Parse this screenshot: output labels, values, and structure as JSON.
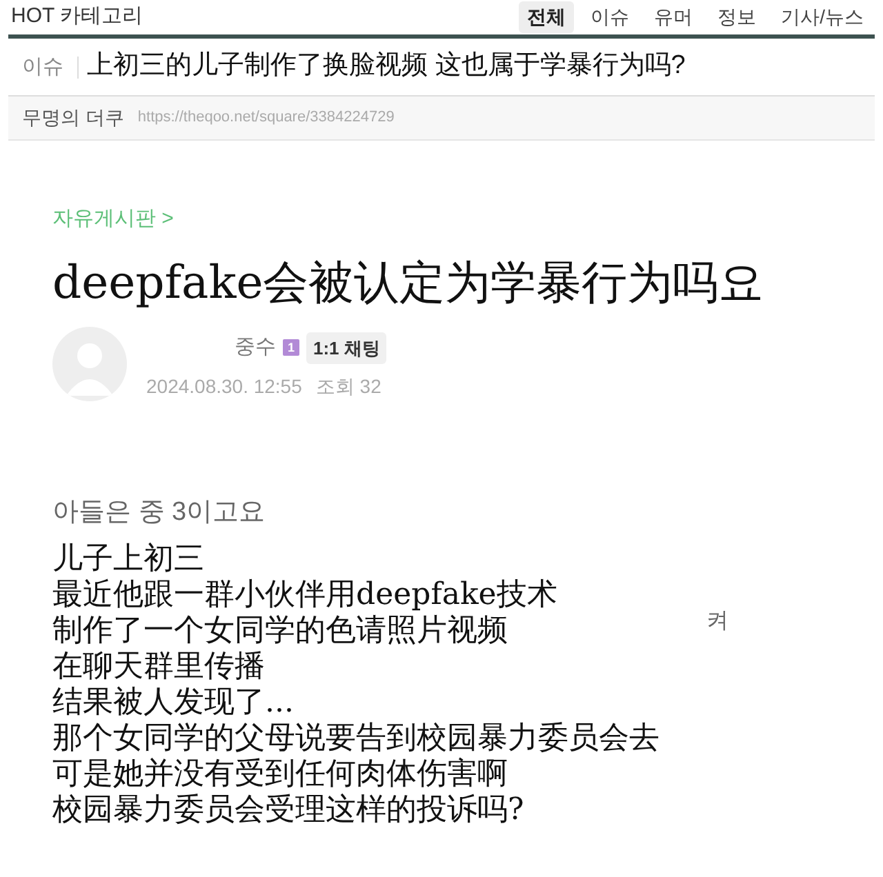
{
  "header": {
    "category": "HOT 카테고리",
    "tabs": [
      {
        "label": "전체",
        "selected": true
      },
      {
        "label": "이슈",
        "selected": false
      },
      {
        "label": "유머",
        "selected": false
      },
      {
        "label": "정보",
        "selected": false
      },
      {
        "label": "기사/뉴스",
        "selected": false
      }
    ]
  },
  "article": {
    "tag": "이슈",
    "title": "上初三的儿子制作了换脸视频 这也属于学暴行为吗?",
    "author": "무명의 더쿠",
    "url": "https://theqoo.net/square/3384224729"
  },
  "post": {
    "board": "자유게시판",
    "board_chevron": ">",
    "title": "deepfake会被认定为学暴行为吗요",
    "author": "중수",
    "level_badge": "1",
    "chat_button": "1:1 채팅",
    "date": "2024.08.30. 12:55",
    "views": "조회 32",
    "intro": "아들은 중 3이고요",
    "lines": [
      "儿子上初三",
      "最近他跟一群小伙伴用deepfake技术",
      "制作了一个女同学的色请照片视频",
      "在聊天群里传播",
      "结果被人发现了...",
      "那个女同学的父母说要告到校园暴力委员会去",
      "可是她并没有受到任何肉体伤害啊",
      "校园暴力委员会受理这样的投诉吗?"
    ],
    "stray_text": "켜"
  }
}
